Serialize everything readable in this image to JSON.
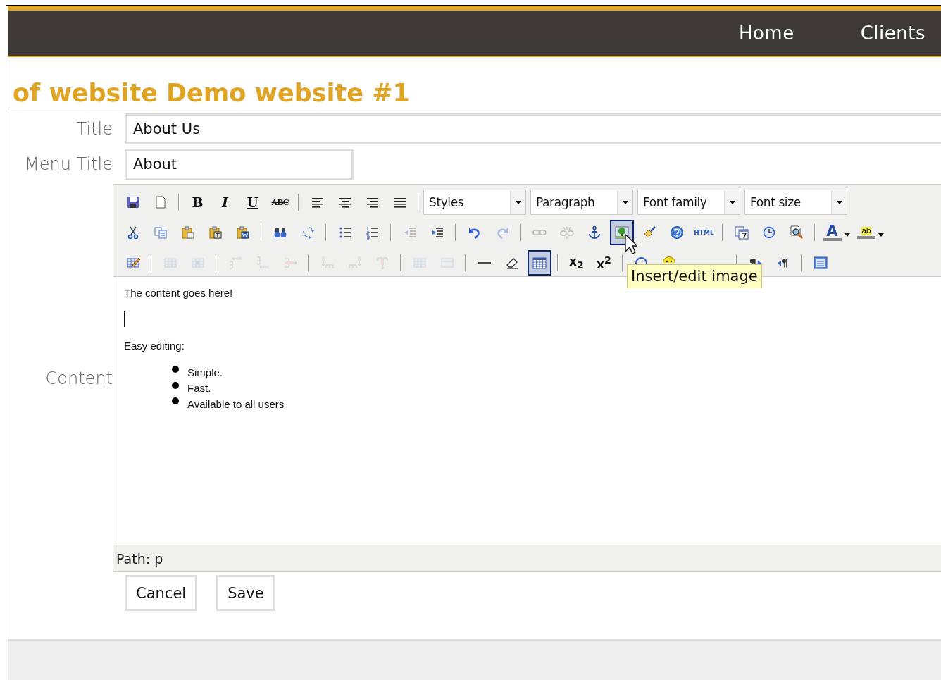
{
  "nav": [
    "Home",
    "Clients"
  ],
  "heading": "of website Demo website #1",
  "fields": [
    {
      "label": "Title",
      "value": "About Us",
      "kind": "wide"
    },
    {
      "label": "Menu Title",
      "value": "About",
      "kind": "narrow"
    }
  ],
  "editor": {
    "label": "Content",
    "toolbar": {
      "rows": [
        {
          "items": [
            {
              "kind": "save",
              "disabled": false,
              "active": false
            },
            {
              "kind": "newdoc",
              "disabled": false,
              "active": false
            },
            {
              "kind": "sep"
            },
            {
              "kind": "bold",
              "label": "B",
              "disabled": false,
              "active": false
            },
            {
              "kind": "italic",
              "label": "I",
              "disabled": false,
              "active": false
            },
            {
              "kind": "underline",
              "label": "U",
              "disabled": false,
              "active": false
            },
            {
              "kind": "strike",
              "label": "ABC",
              "disabled": false,
              "active": false
            },
            {
              "kind": "sep"
            },
            {
              "kind": "alignleft",
              "disabled": false,
              "active": false
            },
            {
              "kind": "aligncenter",
              "disabled": false,
              "active": false
            },
            {
              "kind": "alignright",
              "disabled": false,
              "active": false
            },
            {
              "kind": "justify",
              "disabled": false,
              "active": false
            },
            {
              "kind": "sep"
            },
            {
              "kind": "select",
              "label": "Styles"
            },
            {
              "kind": "select",
              "label": "Paragraph"
            },
            {
              "kind": "select",
              "label": "Font family"
            },
            {
              "kind": "select",
              "label": "Font size"
            }
          ]
        },
        {
          "items": [
            {
              "kind": "cut",
              "disabled": false,
              "active": false
            },
            {
              "kind": "copy",
              "disabled": false,
              "active": false
            },
            {
              "kind": "paste",
              "disabled": false,
              "active": false
            },
            {
              "kind": "pastetext",
              "disabled": false,
              "active": false
            },
            {
              "kind": "pasteword",
              "disabled": false,
              "active": false
            },
            {
              "kind": "sep"
            },
            {
              "kind": "find",
              "disabled": false,
              "active": false
            },
            {
              "kind": "replace",
              "disabled": false,
              "active": false
            },
            {
              "kind": "sep"
            },
            {
              "kind": "bullist",
              "disabled": false,
              "active": false
            },
            {
              "kind": "numlist",
              "disabled": false,
              "active": false
            },
            {
              "kind": "sep"
            },
            {
              "kind": "outdent",
              "disabled": true,
              "active": false
            },
            {
              "kind": "indent",
              "disabled": false,
              "active": false
            },
            {
              "kind": "sep"
            },
            {
              "kind": "undo",
              "disabled": false,
              "active": false
            },
            {
              "kind": "redo",
              "disabled": true,
              "active": false
            },
            {
              "kind": "sep"
            },
            {
              "kind": "link",
              "disabled": true,
              "active": false
            },
            {
              "kind": "unlink",
              "disabled": true,
              "active": false
            },
            {
              "kind": "anchor",
              "disabled": false,
              "active": false
            },
            {
              "kind": "image",
              "disabled": false,
              "active": true
            },
            {
              "kind": "cleanup",
              "disabled": false,
              "active": false
            },
            {
              "kind": "help",
              "disabled": false,
              "active": false
            },
            {
              "kind": "html",
              "label": "HTML",
              "disabled": false,
              "active": false
            },
            {
              "kind": "sep"
            },
            {
              "kind": "date",
              "disabled": false,
              "active": false
            },
            {
              "kind": "time",
              "disabled": false,
              "active": false
            },
            {
              "kind": "preview",
              "disabled": false,
              "active": false
            },
            {
              "kind": "sep"
            },
            {
              "kind": "forecolor",
              "label": "A",
              "disabled": false,
              "active": false
            },
            {
              "kind": "backcolor",
              "label": "ab",
              "disabled": false,
              "active": false
            }
          ]
        },
        {
          "items": [
            {
              "kind": "tableprops",
              "disabled": false,
              "active": false
            },
            {
              "kind": "sep"
            },
            {
              "kind": "rowprops",
              "disabled": true,
              "active": false
            },
            {
              "kind": "cellprops",
              "disabled": true,
              "active": false
            },
            {
              "kind": "sep"
            },
            {
              "kind": "rowbefore",
              "disabled": true,
              "active": false
            },
            {
              "kind": "rowafter",
              "disabled": true,
              "active": false
            },
            {
              "kind": "deleterow",
              "disabled": true,
              "active": false
            },
            {
              "kind": "sep"
            },
            {
              "kind": "colbefore",
              "disabled": true,
              "active": false
            },
            {
              "kind": "colafter",
              "disabled": true,
              "active": false
            },
            {
              "kind": "deletecol",
              "disabled": true,
              "active": false
            },
            {
              "kind": "sep"
            },
            {
              "kind": "split",
              "disabled": true,
              "active": false
            },
            {
              "kind": "merge",
              "disabled": true,
              "active": false
            },
            {
              "kind": "sep"
            },
            {
              "kind": "hr",
              "disabled": false,
              "active": false
            },
            {
              "kind": "eraser",
              "disabled": false,
              "active": false
            },
            {
              "kind": "table",
              "disabled": false,
              "active": true
            },
            {
              "kind": "sep"
            },
            {
              "kind": "sub",
              "label": "x$_{2}$",
              "disabled": false,
              "active": false
            },
            {
              "kind": "sup",
              "label": "x$^{2}$",
              "disabled": false,
              "active": false
            },
            {
              "kind": "sep"
            },
            {
              "kind": "media",
              "disabled": false,
              "active": false
            },
            {
              "kind": "smiley",
              "disabled": false,
              "active": false
            },
            {
              "kind": "blank"
            },
            {
              "kind": "sep"
            },
            {
              "kind": "ltr",
              "disabled": false,
              "active": false
            },
            {
              "kind": "rtl",
              "disabled": false,
              "active": false
            },
            {
              "kind": "sep"
            },
            {
              "kind": "fullscreen",
              "disabled": false,
              "active": false
            }
          ]
        }
      ]
    },
    "tooltip": "Insert/edit image",
    "content": {
      "paragraphs": [
        "The content goes here!",
        "Easy editing:"
      ],
      "bullets": [
        "Simple.",
        "Fast.",
        "Available to all users"
      ]
    },
    "path": "Path: p"
  },
  "buttons": [
    "Cancel",
    "Save"
  ]
}
